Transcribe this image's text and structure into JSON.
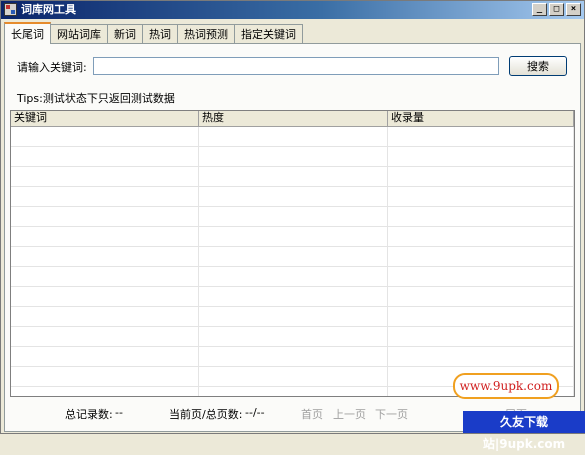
{
  "window": {
    "title": "词库网工具",
    "controls": [
      "0",
      "1",
      "r"
    ]
  },
  "tabs": [
    {
      "label": "长尾词",
      "active": true
    },
    {
      "label": "网站词库"
    },
    {
      "label": "新词"
    },
    {
      "label": "热词"
    },
    {
      "label": "热词预测"
    },
    {
      "label": "指定关键词"
    }
  ],
  "search": {
    "label": "请输入关键词:",
    "value": "",
    "button": "搜索"
  },
  "tips": "Tips:测试状态下只返回测试数据",
  "table": {
    "headers": [
      "关键词",
      "热度",
      "收录量"
    ],
    "rows": []
  },
  "status": {
    "total_label": "总记录数:",
    "total_value": "--",
    "page_label": "当前页/总页数:",
    "page_value": "--/--"
  },
  "pager": {
    "first": "首页",
    "prev": "上一页",
    "next": "下一页",
    "last": "尾页"
  },
  "watermark": {
    "url": "www.9upk.com",
    "site": "久友下载站|9upk.com"
  }
}
